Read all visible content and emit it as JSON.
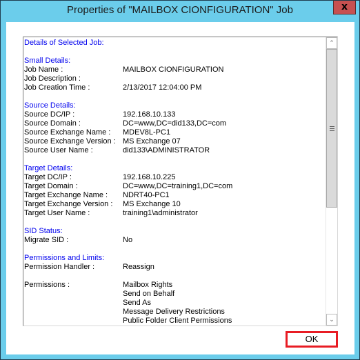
{
  "window": {
    "title": "Properties of \"MAILBOX CIONFIGURATION\" Job",
    "close_glyph": "x"
  },
  "details": {
    "header": "Details of Selected Job:",
    "small_details": {
      "heading": "Small Details:",
      "rows": [
        {
          "label": "Job Name :",
          "value": "MAILBOX CIONFIGURATION"
        },
        {
          "label": "Job Description :",
          "value": ""
        },
        {
          "label": "Job Creation Time :",
          "value": "2/13/2017 12:04:00 PM"
        }
      ]
    },
    "source_details": {
      "heading": "Source Details:",
      "rows": [
        {
          "label": "Source DC/IP :",
          "value": "192.168.10.133"
        },
        {
          "label": "Source Domain :",
          "value": "DC=www,DC=did133,DC=com"
        },
        {
          "label": "Source Exchange Name :",
          "value": "MDEV8L-PC1"
        },
        {
          "label": "Source Exchange Version :",
          "value": "MS Exchange 07"
        },
        {
          "label": "Source User Name :",
          "value": "did133\\ADMINISTRATOR"
        }
      ]
    },
    "target_details": {
      "heading": "Target Details:",
      "rows": [
        {
          "label": "Target DC/IP :",
          "value": "192.168.10.225"
        },
        {
          "label": "Target Domain :",
          "value": "DC=www,DC=training1,DC=com"
        },
        {
          "label": "Target Exchange Name :",
          "value": "NDRT40-PC1"
        },
        {
          "label": "Target Exchange Version :",
          "value": "MS Exchange 10"
        },
        {
          "label": "Target User Name :",
          "value": "training1\\administrator"
        }
      ]
    },
    "sid_status": {
      "heading": "SID Status:",
      "rows": [
        {
          "label": "Migrate SID :",
          "value": "No"
        }
      ]
    },
    "permissions_limits": {
      "heading": "Permissions and Limits:",
      "rows": [
        {
          "label": "Permission Handler :",
          "value": "Reassign"
        }
      ]
    },
    "permissions": {
      "label": "Permissions :",
      "values": [
        "Mailbox Rights",
        "Send on Behalf",
        "Send As",
        "Message Delivery Restrictions",
        "Public Folder Client Permissions"
      ]
    }
  },
  "scrollbar": {
    "up_glyph": "^",
    "down_glyph": "v",
    "thumb_fraction": 0.6
  },
  "buttons": {
    "ok_label": "OK"
  }
}
